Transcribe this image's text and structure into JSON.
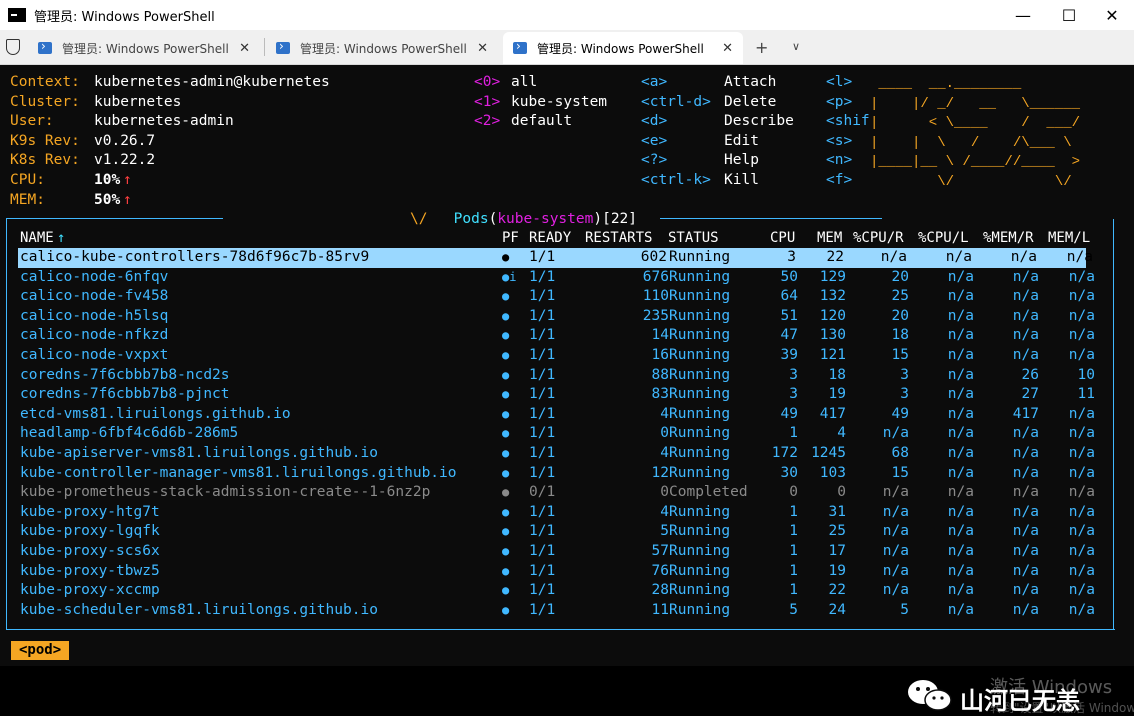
{
  "window": {
    "title": "管理员: Windows PowerShell",
    "minimize": "—",
    "maximize": "☐",
    "close": "✕"
  },
  "tabs": [
    {
      "label": "管理员: Windows PowerShell",
      "close": "✕"
    },
    {
      "label": "管理员: Windows PowerShell",
      "close": "✕"
    },
    {
      "label": "管理员: Windows PowerShell",
      "close": "✕"
    }
  ],
  "tabbar": {
    "new_tab": "+",
    "dropdown": "∨"
  },
  "info": [
    {
      "label": "Context:",
      "value": "kubernetes-admin@kubernetes"
    },
    {
      "label": "Cluster:",
      "value": "kubernetes"
    },
    {
      "label": "User:",
      "value": "kubernetes-admin"
    },
    {
      "label": "K9s Rev:",
      "value": "v0.26.7"
    },
    {
      "label": "K8s Rev:",
      "value": "v1.22.2"
    },
    {
      "label": "CPU:",
      "value": "10%",
      "arrow": "↑"
    },
    {
      "label": "MEM:",
      "value": "50%",
      "arrow": "↑"
    }
  ],
  "namespaces": [
    {
      "key": "<0>",
      "name": "all"
    },
    {
      "key": "<1>",
      "name": "kube-system"
    },
    {
      "key": "<2>",
      "name": "default"
    }
  ],
  "hotkeys": [
    {
      "key": "<a>",
      "action": "Attach",
      "key2": "<l>"
    },
    {
      "key": "<ctrl-d>",
      "action": "Delete",
      "key2": "<p>"
    },
    {
      "key": "<d>",
      "action": "Describe",
      "key2": "<shif"
    },
    {
      "key": "<e>",
      "action": "Edit",
      "key2": "<s>"
    },
    {
      "key": "<?>",
      "action": "Help",
      "key2": "<n>"
    },
    {
      "key": "<ctrl-k>",
      "action": "Kill",
      "key2": "<f>"
    }
  ],
  "logo": " ____  __.________\n|    |/ _/   __   \\______\n|      < \\____    /  ___/\n|    |  \\   /    /\\___ \\\n|____|__ \\ /____//____  >\n        \\/            \\/",
  "frame": {
    "caret": "\\/",
    "resource": "Pods",
    "namespace": "kube-system",
    "count": "[22]"
  },
  "headers": {
    "name": "NAME",
    "sort_arrow": "↑",
    "pf": "PF",
    "ready": "READY",
    "restarts": "RESTARTS",
    "status": "STATUS",
    "cpu": "CPU",
    "mem": "MEM",
    "cpu_r": "%CPU/R",
    "cpu_l": "%CPU/L",
    "mem_r": "%MEM/R",
    "mem_l": "MEM/L"
  },
  "pods": [
    {
      "name": "calico-kube-controllers-78d6f96c7b-85rv9",
      "pf": "●",
      "ready": "1/1",
      "restarts": "602",
      "status": "Running",
      "cpu": "3",
      "mem": "22",
      "cpu_r": "n/a",
      "cpu_l": "n/a",
      "mem_r": "n/a",
      "mem_l": "n/a"
    },
    {
      "name": "calico-node-6nfqv",
      "pf": "●i",
      "ready": "1/1",
      "restarts": "676",
      "status": "Running",
      "cpu": "50",
      "mem": "129",
      "cpu_r": "20",
      "cpu_l": "n/a",
      "mem_r": "n/a",
      "mem_l": "n/a"
    },
    {
      "name": "calico-node-fv458",
      "pf": "●",
      "ready": "1/1",
      "restarts": "110",
      "status": "Running",
      "cpu": "64",
      "mem": "132",
      "cpu_r": "25",
      "cpu_l": "n/a",
      "mem_r": "n/a",
      "mem_l": "n/a"
    },
    {
      "name": "calico-node-h5lsq",
      "pf": "●",
      "ready": "1/1",
      "restarts": "235",
      "status": "Running",
      "cpu": "51",
      "mem": "120",
      "cpu_r": "20",
      "cpu_l": "n/a",
      "mem_r": "n/a",
      "mem_l": "n/a"
    },
    {
      "name": "calico-node-nfkzd",
      "pf": "●",
      "ready": "1/1",
      "restarts": "14",
      "status": "Running",
      "cpu": "47",
      "mem": "130",
      "cpu_r": "18",
      "cpu_l": "n/a",
      "mem_r": "n/a",
      "mem_l": "n/a"
    },
    {
      "name": "calico-node-vxpxt",
      "pf": "●",
      "ready": "1/1",
      "restarts": "16",
      "status": "Running",
      "cpu": "39",
      "mem": "121",
      "cpu_r": "15",
      "cpu_l": "n/a",
      "mem_r": "n/a",
      "mem_l": "n/a"
    },
    {
      "name": "coredns-7f6cbbb7b8-ncd2s",
      "pf": "●",
      "ready": "1/1",
      "restarts": "88",
      "status": "Running",
      "cpu": "3",
      "mem": "18",
      "cpu_r": "3",
      "cpu_l": "n/a",
      "mem_r": "26",
      "mem_l": "10"
    },
    {
      "name": "coredns-7f6cbbb7b8-pjnct",
      "pf": "●",
      "ready": "1/1",
      "restarts": "83",
      "status": "Running",
      "cpu": "3",
      "mem": "19",
      "cpu_r": "3",
      "cpu_l": "n/a",
      "mem_r": "27",
      "mem_l": "11"
    },
    {
      "name": "etcd-vms81.liruilongs.github.io",
      "pf": "●",
      "ready": "1/1",
      "restarts": "4",
      "status": "Running",
      "cpu": "49",
      "mem": "417",
      "cpu_r": "49",
      "cpu_l": "n/a",
      "mem_r": "417",
      "mem_l": "n/a"
    },
    {
      "name": "headlamp-6fbf4c6d6b-286m5",
      "pf": "●",
      "ready": "1/1",
      "restarts": "0",
      "status": "Running",
      "cpu": "1",
      "mem": "4",
      "cpu_r": "n/a",
      "cpu_l": "n/a",
      "mem_r": "n/a",
      "mem_l": "n/a"
    },
    {
      "name": "kube-apiserver-vms81.liruilongs.github.io",
      "pf": "●",
      "ready": "1/1",
      "restarts": "4",
      "status": "Running",
      "cpu": "172",
      "mem": "1245",
      "cpu_r": "68",
      "cpu_l": "n/a",
      "mem_r": "n/a",
      "mem_l": "n/a"
    },
    {
      "name": "kube-controller-manager-vms81.liruilongs.github.io",
      "pf": "●",
      "ready": "1/1",
      "restarts": "12",
      "status": "Running",
      "cpu": "30",
      "mem": "103",
      "cpu_r": "15",
      "cpu_l": "n/a",
      "mem_r": "n/a",
      "mem_l": "n/a"
    },
    {
      "name": "kube-prometheus-stack-admission-create--1-6nz2p",
      "pf": "●",
      "ready": "0/1",
      "restarts": "0",
      "status": "Completed",
      "cpu": "0",
      "mem": "0",
      "cpu_r": "n/a",
      "cpu_l": "n/a",
      "mem_r": "n/a",
      "mem_l": "n/a"
    },
    {
      "name": "kube-proxy-htg7t",
      "pf": "●",
      "ready": "1/1",
      "restarts": "4",
      "status": "Running",
      "cpu": "1",
      "mem": "31",
      "cpu_r": "n/a",
      "cpu_l": "n/a",
      "mem_r": "n/a",
      "mem_l": "n/a"
    },
    {
      "name": "kube-proxy-lgqfk",
      "pf": "●",
      "ready": "1/1",
      "restarts": "5",
      "status": "Running",
      "cpu": "1",
      "mem": "25",
      "cpu_r": "n/a",
      "cpu_l": "n/a",
      "mem_r": "n/a",
      "mem_l": "n/a"
    },
    {
      "name": "kube-proxy-scs6x",
      "pf": "●",
      "ready": "1/1",
      "restarts": "57",
      "status": "Running",
      "cpu": "1",
      "mem": "17",
      "cpu_r": "n/a",
      "cpu_l": "n/a",
      "mem_r": "n/a",
      "mem_l": "n/a"
    },
    {
      "name": "kube-proxy-tbwz5",
      "pf": "●",
      "ready": "1/1",
      "restarts": "76",
      "status": "Running",
      "cpu": "1",
      "mem": "19",
      "cpu_r": "n/a",
      "cpu_l": "n/a",
      "mem_r": "n/a",
      "mem_l": "n/a"
    },
    {
      "name": "kube-proxy-xccmp",
      "pf": "●",
      "ready": "1/1",
      "restarts": "28",
      "status": "Running",
      "cpu": "1",
      "mem": "22",
      "cpu_r": "n/a",
      "cpu_l": "n/a",
      "mem_r": "n/a",
      "mem_l": "n/a"
    },
    {
      "name": "kube-scheduler-vms81.liruilongs.github.io",
      "pf": "●",
      "ready": "1/1",
      "restarts": "11",
      "status": "Running",
      "cpu": "5",
      "mem": "24",
      "cpu_r": "5",
      "cpu_l": "n/a",
      "mem_r": "n/a",
      "mem_l": "n/a"
    }
  ],
  "breadcrumb": "<pod>",
  "watermark": {
    "account": "山河已无恙",
    "activate": "激活 Windows",
    "activate_sub": "转到\"设置\"以激活 Windows"
  },
  "colors": {
    "orange": "#f5a623",
    "blue": "#40b8ff",
    "magenta": "#e020e0",
    "selected_row": "#9ad8ff"
  }
}
